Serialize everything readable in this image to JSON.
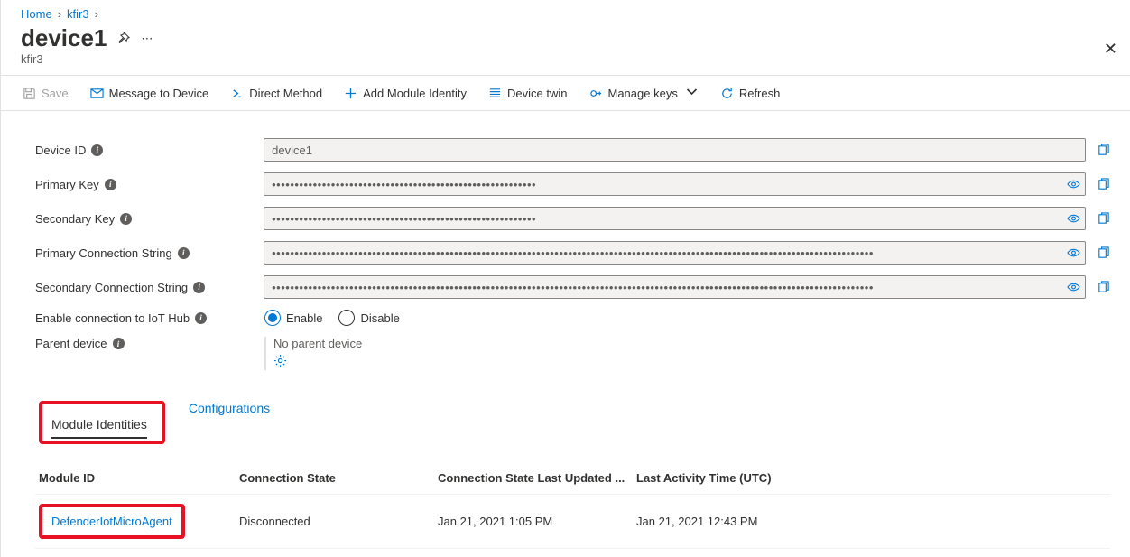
{
  "breadcrumb": {
    "home": "Home",
    "hub": "kfir3"
  },
  "page": {
    "title": "device1",
    "subtitle": "kfir3"
  },
  "commands": {
    "save": "Save",
    "message": "Message to Device",
    "direct": "Direct Method",
    "addModule": "Add Module Identity",
    "twin": "Device twin",
    "manageKeys": "Manage keys",
    "refresh": "Refresh"
  },
  "labels": {
    "deviceId": "Device ID",
    "primaryKey": "Primary Key",
    "secondaryKey": "Secondary Key",
    "primaryConn": "Primary Connection String",
    "secondaryConn": "Secondary Connection String",
    "enableConn": "Enable connection to IoT Hub",
    "parent": "Parent device"
  },
  "values": {
    "deviceId": "device1",
    "primaryKey": "••••••••••••••••••••••••••••••••••••••••••••••••••••••••••",
    "secondaryKey": "••••••••••••••••••••••••••••••••••••••••••••••••••••••••••",
    "primaryConn": "••••••••••••••••••••••••••••••••••••••••••••••••••••••••••••••••••••••••••••••••••••••••••••••••••••••••••••••••••••••••••••••••••••",
    "secondaryConn": "••••••••••••••••••••••••••••••••••••••••••••••••••••••••••••••••••••••••••••••••••••••••••••••••••••••••••••••••••••••••••••••••••••",
    "enable": "Enable",
    "disable": "Disable",
    "noParent": "No parent device"
  },
  "tabs": {
    "modules": "Module Identities",
    "configs": "Configurations"
  },
  "table": {
    "headers": {
      "moduleId": "Module ID",
      "connState": "Connection State",
      "connUpdated": "Connection State Last Updated ...",
      "lastActivity": "Last Activity Time (UTC)"
    },
    "rows": [
      {
        "moduleId": "DefenderIotMicroAgent",
        "connState": "Disconnected",
        "connUpdated": "Jan 21, 2021 1:05 PM",
        "lastActivity": "Jan 21, 2021 12:43 PM"
      }
    ]
  }
}
